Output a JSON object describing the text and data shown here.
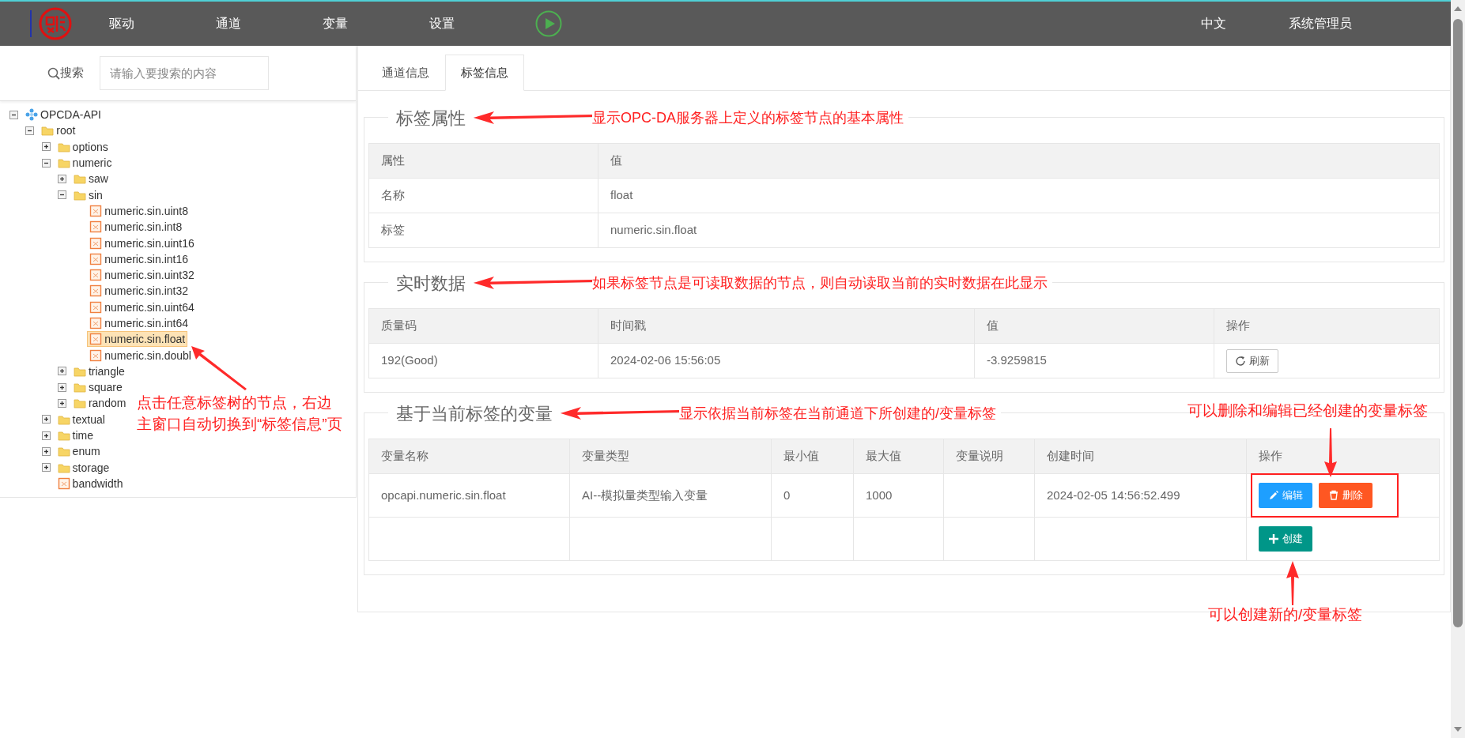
{
  "header": {
    "nav": [
      {
        "label": "驱动"
      },
      {
        "label": "通道"
      },
      {
        "label": "变量"
      },
      {
        "label": "设置"
      }
    ],
    "language": "中文",
    "user": "系统管理员"
  },
  "search": {
    "label": "搜索",
    "placeholder": "请输入要搜索的内容"
  },
  "tree": [
    {
      "label": "OPCDA-API",
      "kind": "server",
      "expanded": true,
      "selected": false,
      "children": [
        {
          "label": "root",
          "kind": "folder",
          "expanded": true,
          "selected": false,
          "children": [
            {
              "label": "options",
              "kind": "folder",
              "expanded": false,
              "selected": false
            },
            {
              "label": "numeric",
              "kind": "folder",
              "expanded": true,
              "selected": false,
              "children": [
                {
                  "label": "saw",
                  "kind": "folder",
                  "expanded": false,
                  "selected": false
                },
                {
                  "label": "sin",
                  "kind": "folder",
                  "expanded": true,
                  "selected": false,
                  "children": [
                    {
                      "label": "numeric.sin.uint8",
                      "kind": "tag",
                      "selected": false
                    },
                    {
                      "label": "numeric.sin.int8",
                      "kind": "tag",
                      "selected": false
                    },
                    {
                      "label": "numeric.sin.uint16",
                      "kind": "tag",
                      "selected": false
                    },
                    {
                      "label": "numeric.sin.int16",
                      "kind": "tag",
                      "selected": false
                    },
                    {
                      "label": "numeric.sin.uint32",
                      "kind": "tag",
                      "selected": false
                    },
                    {
                      "label": "numeric.sin.int32",
                      "kind": "tag",
                      "selected": false
                    },
                    {
                      "label": "numeric.sin.uint64",
                      "kind": "tag",
                      "selected": false
                    },
                    {
                      "label": "numeric.sin.int64",
                      "kind": "tag",
                      "selected": false
                    },
                    {
                      "label": "numeric.sin.float",
                      "kind": "tag",
                      "selected": true
                    },
                    {
                      "label": "numeric.sin.doubl",
                      "kind": "tag",
                      "selected": false
                    }
                  ]
                },
                {
                  "label": "triangle",
                  "kind": "folder",
                  "expanded": false,
                  "selected": false
                },
                {
                  "label": "square",
                  "kind": "folder",
                  "expanded": false,
                  "selected": false
                },
                {
                  "label": "random",
                  "kind": "folder",
                  "expanded": false,
                  "selected": false
                }
              ]
            },
            {
              "label": "textual",
              "kind": "folder",
              "expanded": false,
              "selected": false
            },
            {
              "label": "time",
              "kind": "folder",
              "expanded": false,
              "selected": false
            },
            {
              "label": "enum",
              "kind": "folder",
              "expanded": false,
              "selected": false
            },
            {
              "label": "storage",
              "kind": "folder",
              "expanded": false,
              "selected": false
            },
            {
              "label": "bandwidth",
              "kind": "tag",
              "selected": false
            }
          ]
        }
      ]
    }
  ],
  "tabs": [
    {
      "label": "通道信息",
      "selected": false
    },
    {
      "label": "标签信息",
      "selected": true
    }
  ],
  "sections": [
    {
      "title": "标签属性",
      "note": "显示OPC-DA服务器上定义的标签节点的基本属性",
      "table": {
        "columns": [
          "属性",
          "值"
        ],
        "rows": [
          {
            "cells": [
              "名称",
              "float"
            ]
          },
          {
            "cells": [
              "标签",
              "numeric.sin.float"
            ]
          }
        ]
      }
    },
    {
      "title": "实时数据",
      "note": "如果标签节点是可读取数据的节点，则自动读取当前的实时数据在此显示",
      "table": {
        "columns": [
          "质量码",
          "时间戳",
          "值",
          "操作"
        ],
        "rows": [
          {
            "cells": [
              "192(Good)",
              "2024-02-06 15:56:05",
              "-3.9259815"
            ],
            "actions": [
              {
                "kind": "refresh",
                "label": "刷新"
              }
            ]
          }
        ]
      }
    },
    {
      "title": "基于当前标签的变量",
      "note": "显示依据当前标签在当前通道下所创建的/变量标签",
      "table": {
        "columns": [
          "变量名称",
          "变量类型",
          "最小值",
          "最大值",
          "变量说明",
          "创建时间",
          "操作"
        ],
        "rows": [
          {
            "cells": [
              "opcapi.numeric.sin.float",
              "AI--模拟量类型输入变量",
              "0",
              "1000",
              null,
              "2024-02-05 14:56:52.499"
            ],
            "actions": [
              {
                "kind": "edit",
                "label": "编辑"
              },
              {
                "kind": "delete",
                "label": "删除"
              }
            ],
            "highlighted": true
          },
          {
            "cells": [],
            "actions": [
              {
                "kind": "create",
                "label": "创建"
              }
            ]
          }
        ]
      }
    }
  ],
  "annotations": [
    {
      "kind": "tree-note",
      "lines": [
        "点击任意标签树的节点，右边",
        "主窗口自动切换到“标签信息”页"
      ]
    },
    {
      "kind": "actions-note",
      "lines": [
        "可以删除和编辑已经创建的变量标签"
      ]
    },
    {
      "kind": "create-note",
      "lines": [
        "可以创建新的/变量标签"
      ]
    }
  ]
}
